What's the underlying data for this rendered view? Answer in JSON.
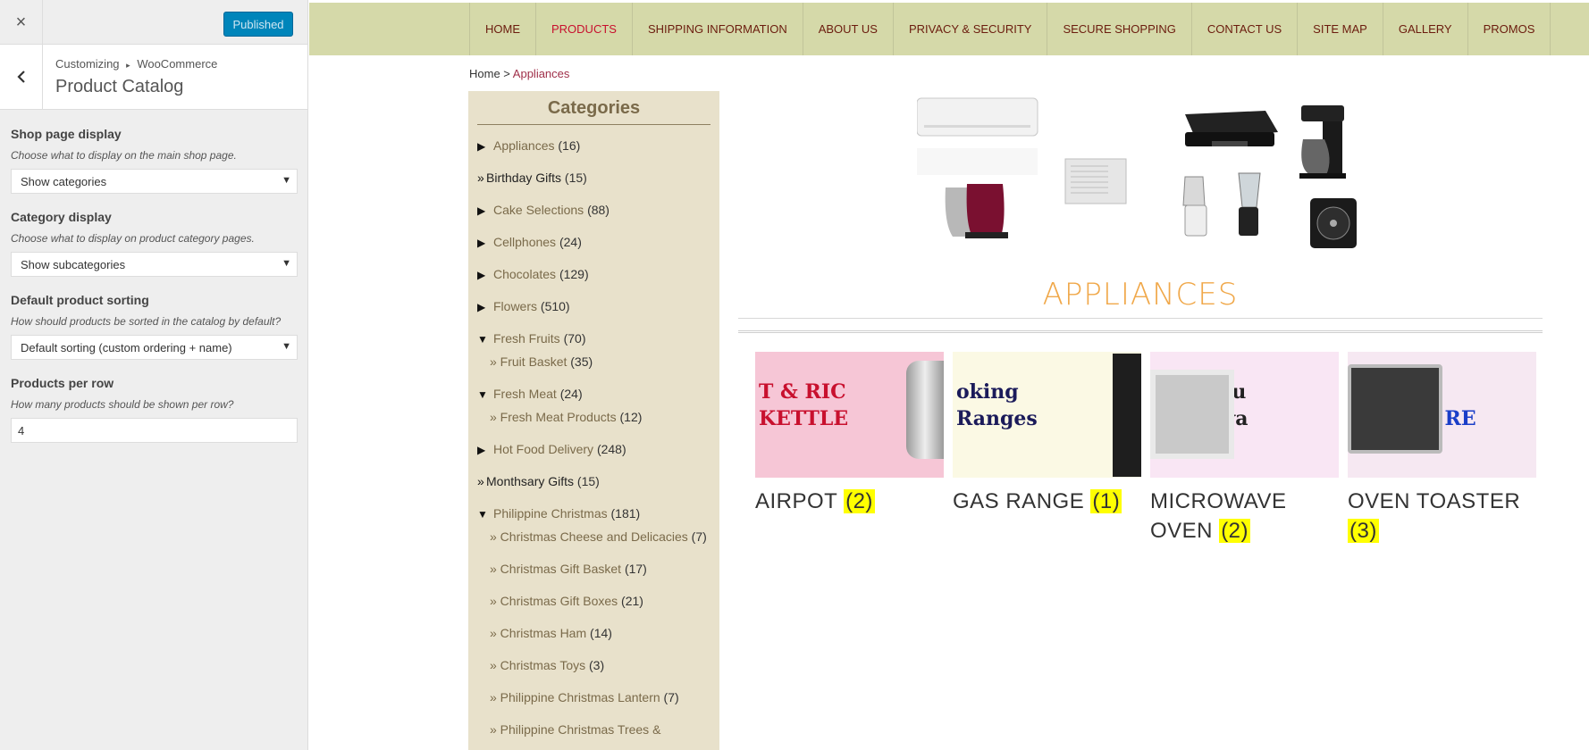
{
  "customizer": {
    "close_label": "×",
    "publish_label": "Published",
    "back_label": "‹",
    "breadcrumb_parent": "Customizing",
    "breadcrumb_sep": "▸",
    "breadcrumb_child": "WooCommerce",
    "section_title": "Product Catalog",
    "controls": [
      {
        "label": "Shop page display",
        "description": "Choose what to display on the main shop page.",
        "value": "Show categories"
      },
      {
        "label": "Category display",
        "description": "Choose what to display on product category pages.",
        "value": "Show subcategories"
      },
      {
        "label": "Default product sorting",
        "description": "How should products be sorted in the catalog by default?",
        "value": "Default sorting (custom ordering + name)"
      },
      {
        "label": "Products per row",
        "description": "How many products should be shown per row?",
        "value": "4"
      }
    ]
  },
  "nav": {
    "items": [
      "HOME",
      "PRODUCTS",
      "SHIPPING INFORMATION",
      "ABOUT US",
      "PRIVACY & SECURITY",
      "SECURE SHOPPING",
      "CONTACT US",
      "SITE MAP",
      "GALLERY",
      "PROMOS"
    ],
    "active_color": "#c8102e"
  },
  "breadcrumb": {
    "home": "Home",
    "sep": " > ",
    "current": "Appliances"
  },
  "sidebar": {
    "title": "Categories",
    "rows": [
      {
        "kind": "cat",
        "tri": "▶",
        "name": "Appliances",
        "count": "(16)",
        "style": "lnk"
      },
      {
        "kind": "cat",
        "tri": "»",
        "name": "Birthday Gifts",
        "count": "(15)",
        "style": "dark"
      },
      {
        "kind": "cat",
        "tri": "▶",
        "name": "Cake Selections",
        "count": "(88)",
        "style": "lnk"
      },
      {
        "kind": "cat",
        "tri": "▶",
        "name": "Cellphones",
        "count": "(24)",
        "style": "lnk"
      },
      {
        "kind": "cat",
        "tri": "▶",
        "name": "Chocolates",
        "count": "(129)",
        "style": "lnk"
      },
      {
        "kind": "cat",
        "tri": "▶",
        "name": "Flowers",
        "count": "(510)",
        "style": "lnk"
      },
      {
        "kind": "cat",
        "tri": "▼",
        "name": "Fresh Fruits",
        "count": "(70)",
        "style": "lnk"
      },
      {
        "kind": "sub",
        "name": "» Fruit Basket",
        "count": "(35)"
      },
      {
        "kind": "cat",
        "tri": "▼",
        "name": "Fresh Meat",
        "count": "(24)",
        "style": "lnk"
      },
      {
        "kind": "sub",
        "name": "» Fresh Meat Products",
        "count": "(12)"
      },
      {
        "kind": "cat",
        "tri": "▶",
        "name": "Hot Food Delivery",
        "count": "(248)",
        "style": "lnk"
      },
      {
        "kind": "cat",
        "tri": "»",
        "name": "Monthsary Gifts",
        "count": "(15)",
        "style": "dark"
      },
      {
        "kind": "cat",
        "tri": "▼",
        "name": "Philippine Christmas",
        "count": "(181)",
        "style": "lnk"
      },
      {
        "kind": "sub",
        "name": "» Christmas Cheese and Delicacies",
        "count": "(7)"
      },
      {
        "kind": "sub",
        "name": "» Christmas Gift Basket",
        "count": "(17)"
      },
      {
        "kind": "sub",
        "name": "» Christmas Gift Boxes",
        "count": "(21)"
      },
      {
        "kind": "sub",
        "name": "» Christmas Ham",
        "count": "(14)"
      },
      {
        "kind": "sub",
        "name": "» Christmas Toys",
        "count": "(3)"
      },
      {
        "kind": "sub",
        "name": "» Philippine Christmas Lantern",
        "count": "(7)"
      },
      {
        "kind": "sub",
        "name": "» Philippine Christmas Trees &",
        "count": ""
      }
    ]
  },
  "category": {
    "heading": "APPLIANCES",
    "products": [
      {
        "name": "AIRPOT",
        "count": "(2)",
        "banner_text": "T & RIC KETTLE",
        "bg": "#f6c6d6"
      },
      {
        "name": "GAS RANGE",
        "count": "(1)",
        "banner_text": "oking Ranges",
        "bg": "#fbf9e4"
      },
      {
        "name": "MICROWAVE OVEN",
        "count": "(2)",
        "banner_text": "High Qu Microwa",
        "bg": "#f9e6f4"
      },
      {
        "name": "OVEN TOASTER",
        "count": "(3)",
        "banner_text": "COOK QUALIT RE FASTE",
        "bg": "#f6e8f2"
      }
    ]
  }
}
